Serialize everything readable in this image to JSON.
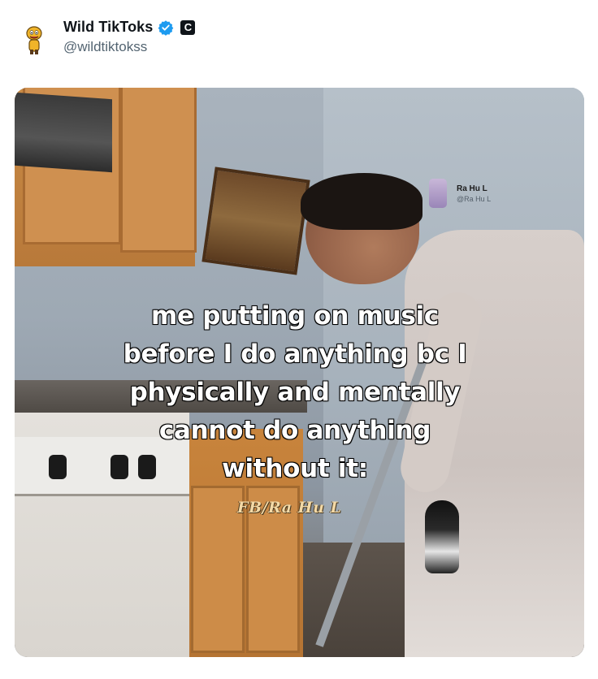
{
  "author": {
    "display_name": "Wild TikToks",
    "handle": "@wildtiktokss",
    "affiliate_badge": "C",
    "verified_color": "#1d9bf0",
    "avatar_icon": "cartoon-character-icon"
  },
  "media": {
    "overlay_credit": {
      "name": "Ra Hu L",
      "handle": "@Ra Hu L"
    },
    "caption_lines": [
      "me putting on music",
      "before I do anything bc I",
      "physically and mentally",
      "cannot do anything",
      "without it:"
    ],
    "watermark": "FB/Ra Hu L"
  }
}
